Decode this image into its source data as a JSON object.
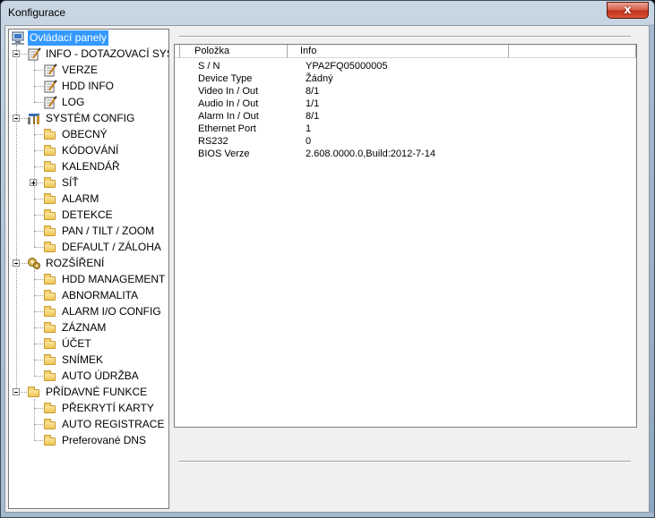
{
  "window": {
    "title": "Konfigurace",
    "close_glyph": "x"
  },
  "tree": {
    "root": "Ovládací panely",
    "info": {
      "label": "INFO - DOTAZOVACÍ SYS",
      "children": [
        "VERZE",
        "HDD INFO",
        "LOG"
      ]
    },
    "system": {
      "label": "SYSTÉM CONFIG",
      "children": [
        "OBECNÝ",
        "KÓDOVÁNÍ",
        "KALENDÁŘ",
        "SÍŤ",
        "ALARM",
        "DETEKCE",
        "PAN / TILT / ZOOM",
        "DEFAULT / ZÁLOHA"
      ]
    },
    "advanced": {
      "label": "ROZŠÍŘENÍ",
      "children": [
        "HDD MANAGEMENT",
        "ABNORMALITA",
        "ALARM I/O CONFIG",
        "ZÁZNAM",
        "ÚČET",
        "SNÍMEK",
        "AUTO ÚDRŽBA"
      ]
    },
    "extra": {
      "label": "PŘÍDAVNÉ FUNKCE",
      "children": [
        "PŘEKRYTÍ KARTY",
        "AUTO REGISTRACE",
        "Preferované DNS"
      ]
    }
  },
  "table": {
    "columns": [
      "Položka",
      "Info"
    ],
    "rows": [
      {
        "key": "S / N",
        "value": "YPA2FQ05000005"
      },
      {
        "key": "Device Type",
        "value": "Žádný"
      },
      {
        "key": "Video In / Out",
        "value": "8/1"
      },
      {
        "key": "Audio In / Out",
        "value": "1/1"
      },
      {
        "key": "Alarm In / Out",
        "value": "8/1"
      },
      {
        "key": "Ethernet Port",
        "value": "1"
      },
      {
        "key": "RS232",
        "value": "0"
      },
      {
        "key": "BIOS Verze",
        "value": "2.608.0000.0,Build:2012-7-14"
      }
    ]
  },
  "icons": {
    "root": "computer-icon",
    "info": "notepad-pencil-icon",
    "leaf_info": "notepad-pencil-icon",
    "system": "tools-icon",
    "advanced": "gears-icon",
    "folder": "folder-icon"
  },
  "colors": {
    "selection": "#3399ff",
    "close_button": "#c2321b"
  }
}
